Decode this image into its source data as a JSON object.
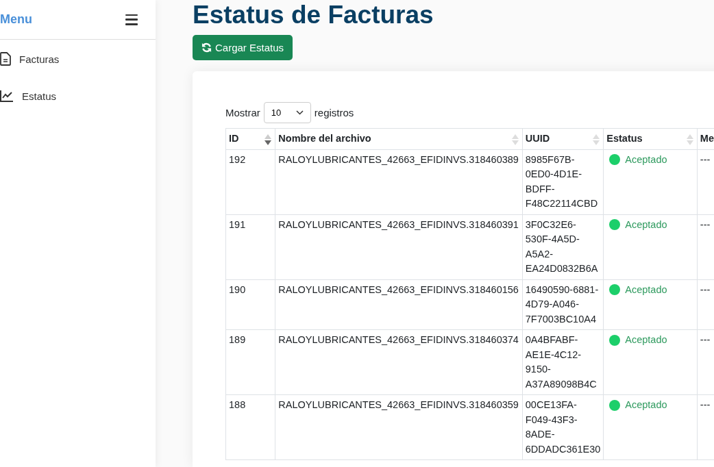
{
  "sidebar": {
    "title": "Menu",
    "items": [
      {
        "label": "Facturas",
        "kind": "document"
      },
      {
        "label": "Estatus",
        "kind": "chart"
      }
    ]
  },
  "page": {
    "title": "Estatus de Facturas",
    "load_button": "Cargar Estatus"
  },
  "table_controls": {
    "show_label": "Mostrar",
    "page_size": "10",
    "records_label": "registros"
  },
  "table": {
    "columns": [
      {
        "label": "ID",
        "sorted": true
      },
      {
        "label": "Nombre del archivo",
        "sorted": false
      },
      {
        "label": "UUID",
        "sorted": false
      },
      {
        "label": "Estatus",
        "sorted": false
      },
      {
        "label": "Me"
      }
    ],
    "rows": [
      {
        "id": "192",
        "file": "RALOYLUBRICANTES_42663_EFIDINVS.318460389",
        "uuid": "8985F67B-0ED0-4D1E-BDFF-F48C22114CBD",
        "status": "Aceptado",
        "color": "#1ccf6a",
        "column_5": "---"
      },
      {
        "id": "191",
        "file": "RALOYLUBRICANTES_42663_EFIDINVS.318460391",
        "uuid": "3F0C32E6-530F-4A5D-A5A2-EA24D0832B6A",
        "status": "Aceptado",
        "color": "#1ccf6a",
        "column_5": "---"
      },
      {
        "id": "190",
        "file": "RALOYLUBRICANTES_42663_EFIDINVS.318460156",
        "uuid": "16490590-6881-4D79-A046-7F7003BC10A4",
        "status": "Aceptado",
        "color": "#1ccf6a",
        "column_5": "---"
      },
      {
        "id": "189",
        "file": "RALOYLUBRICANTES_42663_EFIDINVS.318460374",
        "uuid": "0A4BFABF-AE1E-4C12-9150-A37A89098B4C",
        "status": "Aceptado",
        "color": "#1ccf6a",
        "column_5": "---"
      },
      {
        "id": "188",
        "file": "RALOYLUBRICANTES_42663_EFIDINVS.318460359",
        "uuid": "00CE13FA-F049-43F3-8ADE-6DDADC361E30",
        "status": "Aceptado",
        "color": "#1ccf6a",
        "column_5": "---"
      }
    ]
  }
}
